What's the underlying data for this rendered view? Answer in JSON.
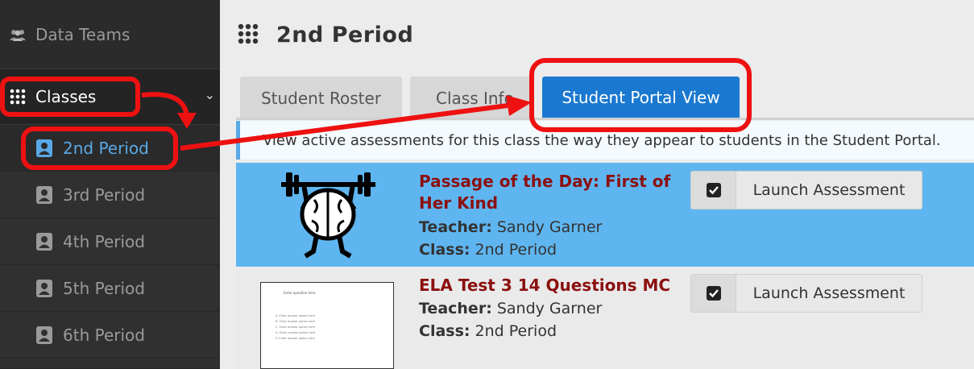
{
  "sidebar": {
    "data_teams_label": "Data Teams",
    "classes_label": "Classes",
    "items": [
      {
        "label": "2nd Period"
      },
      {
        "label": "3rd Period"
      },
      {
        "label": "4th Period"
      },
      {
        "label": "5th Period"
      },
      {
        "label": "6th Period"
      }
    ]
  },
  "header": {
    "title": "2nd Period"
  },
  "tabs": [
    {
      "label": "Student Roster"
    },
    {
      "label": "Class Info"
    },
    {
      "label": "Student Portal View"
    }
  ],
  "info_text": "View active assessments for this class the way they appear to students in the Student Portal.",
  "assessments": [
    {
      "title": "Passage of the Day: First of Her Kind",
      "teacher_label": "Teacher:",
      "teacher": "Sandy Garner",
      "class_label": "Class:",
      "class": "2nd Period",
      "launch_label": "Launch Assessment"
    },
    {
      "title": "ELA Test 3 14 Questions MC",
      "teacher_label": "Teacher:",
      "teacher": "Sandy Garner",
      "class_label": "Class:",
      "class": "2nd Period",
      "launch_label": "Launch Assessment"
    }
  ],
  "thumb2": {
    "heading": "Enter question here",
    "options": [
      "A. Enter answer option here",
      "B. Enter answer option here",
      "C. Enter answer option here",
      "D. Enter answer option here",
      "E. Enter answer option here"
    ]
  },
  "colors": {
    "accent": "#1a78d0",
    "annotation": "#ee1111",
    "highlight_row": "#5fb5ef",
    "title_red": "#8b1010"
  }
}
